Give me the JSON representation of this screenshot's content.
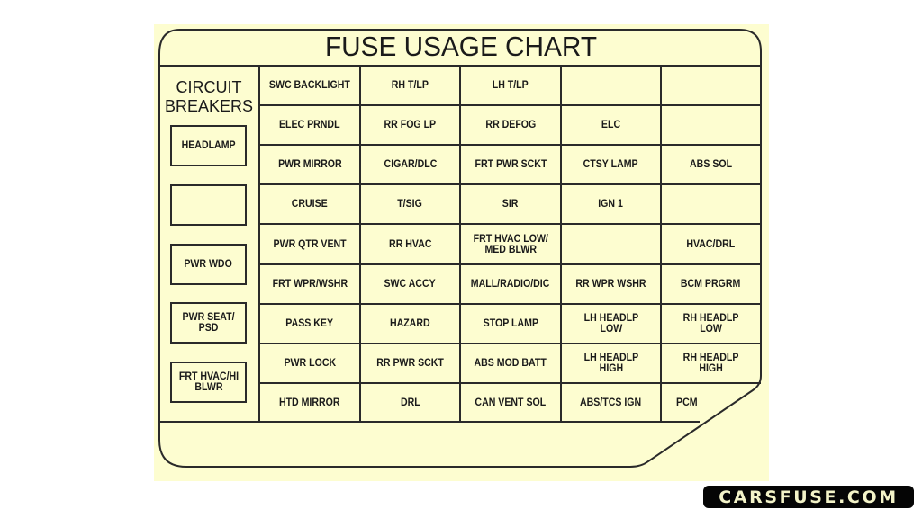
{
  "chart": {
    "title": "FUSE USAGE CHART",
    "circuit_breakers": {
      "heading_line1": "CIRCUIT",
      "heading_line2": "BREAKERS",
      "items": [
        "HEADLAMP",
        "",
        "PWR WDO",
        "PWR SEAT/\nPSD",
        "FRT HVAC/HI\nBLWR"
      ]
    },
    "fuses": {
      "rows": [
        [
          "SWC BACKLIGHT",
          "RH T/LP",
          "LH T/LP",
          "",
          ""
        ],
        [
          "ELEC PRNDL",
          "RR FOG LP",
          "RR DEFOG",
          "ELC",
          ""
        ],
        [
          "PWR MIRROR",
          "CIGAR/DLC",
          "FRT PWR SCKT",
          "CTSY LAMP",
          "ABS SOL"
        ],
        [
          "CRUISE",
          "T/SIG",
          "SIR",
          "IGN 1",
          ""
        ],
        [
          "PWR QTR VENT",
          "RR HVAC",
          "FRT HVAC LOW/\nMED BLWR",
          "",
          "HVAC/DRL"
        ],
        [
          "FRT WPR/WSHR",
          "SWC ACCY",
          "MALL/RADIO/DIC",
          "RR WPR WSHR",
          "BCM PRGRM"
        ],
        [
          "PASS KEY",
          "HAZARD",
          "STOP LAMP",
          "LH HEADLP\nLOW",
          "RH HEADLP\nLOW"
        ],
        [
          "PWR LOCK",
          "RR PWR SCKT",
          "ABS MOD BATT",
          "LH HEADLP\nHIGH",
          "RH HEADLP\nHIGH"
        ],
        [
          "HTD MIRROR",
          "DRL",
          "CAN VENT SOL",
          "ABS/TCS IGN",
          "PCM"
        ]
      ]
    }
  },
  "watermark": {
    "text": "CARSFUSE.COM"
  },
  "colors": {
    "panel": "#fdfdd0",
    "line": "#2a2a2a",
    "watermark_bg": "#050505",
    "watermark_text": "#f3f3c8"
  }
}
